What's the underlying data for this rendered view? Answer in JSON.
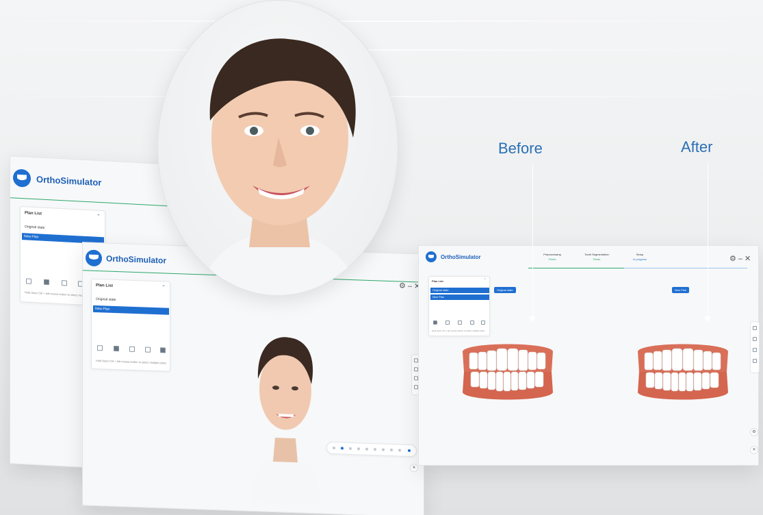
{
  "app_name": "OrthoSimulator",
  "annotations": {
    "before": "Before",
    "after": "After"
  },
  "window_controls": {
    "settings": "⚙",
    "minimize": "–",
    "close": "✕"
  },
  "plan_list": {
    "title": "Plan List",
    "items": [
      "Original state",
      "New Plan"
    ],
    "selected": "New Plan",
    "hint": "Hold down Ctrl + left mouse button to select multiple plans"
  },
  "stepper": {
    "steps": [
      {
        "label": "Preprocessing",
        "status": "Finish"
      },
      {
        "label": "Tooth Segmentation",
        "status": "Finish"
      },
      {
        "label": "Setup",
        "status": "In progress"
      }
    ]
  },
  "comparison": {
    "left_tag": "Original state",
    "right_tag": "New Plan"
  },
  "colors": {
    "accent": "#1f6fd1",
    "callout": "#2a6fb5",
    "success": "#2aa86a"
  }
}
